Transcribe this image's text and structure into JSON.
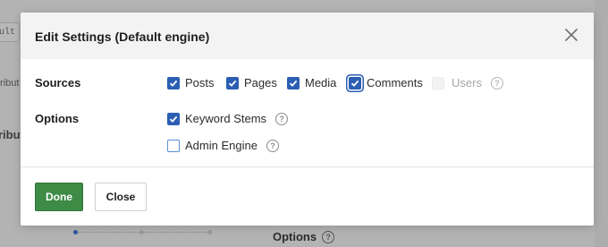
{
  "background": {
    "chip_text": "ult",
    "side_text_a": "tribut",
    "side_text_b": "ribut",
    "options_label": "Options",
    "options_help": "?"
  },
  "modal": {
    "title": "Edit Settings (Default engine)",
    "sources_label": "Sources",
    "options_label": "Options",
    "sources": [
      {
        "label": "Posts",
        "checked": true
      },
      {
        "label": "Pages",
        "checked": true
      },
      {
        "label": "Media",
        "checked": true
      },
      {
        "label": "Comments",
        "checked": true,
        "focused": true
      },
      {
        "label": "Users",
        "checked": false,
        "disabled": true,
        "help": "?"
      }
    ],
    "options": [
      {
        "label": "Keyword Stems",
        "checked": true,
        "help": "?"
      },
      {
        "label": "Admin Engine",
        "checked": false,
        "help": "?"
      }
    ],
    "done_label": "Done",
    "close_label": "Close"
  },
  "colors": {
    "primary_blue": "#2c5fb3",
    "done_green": "#3d8b45"
  }
}
